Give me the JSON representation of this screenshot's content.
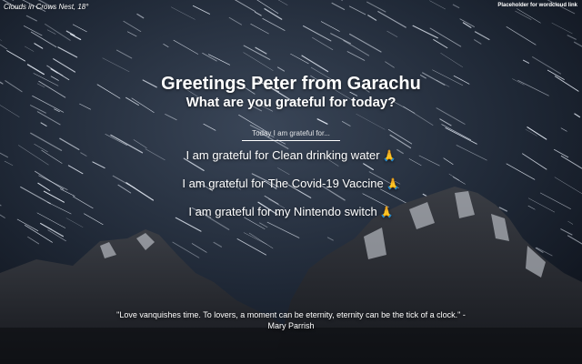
{
  "weather": {
    "text": "Clouds in Crows Nest, 18°"
  },
  "wordcloud": {
    "link_label": "Placeholder for wordcloud link"
  },
  "greeting": {
    "title": "Greetings Peter from Garachu",
    "question": "What are you grateful for today?"
  },
  "input": {
    "placeholder": "Today I am grateful for..."
  },
  "grateful_items": [
    {
      "text": "I am grateful for Clean drinking water",
      "icon": "praying-hands-icon",
      "emoji": "🙏"
    },
    {
      "text": "I am grateful for The Covid-19 Vaccine",
      "icon": "praying-hands-icon",
      "emoji": "🙏"
    },
    {
      "text": "I am grateful for my Nintendo switch",
      "icon": "praying-hands-icon",
      "emoji": "🙏"
    }
  ],
  "quote": {
    "text": "\"Love vanquishes time. To lovers, a moment can be eternity, eternity can be the tick of a clock.\" - Mary Parrish"
  },
  "colors": {
    "text": "#ffffff",
    "sky": "#0e1420",
    "emoji": "#f2b33d"
  }
}
